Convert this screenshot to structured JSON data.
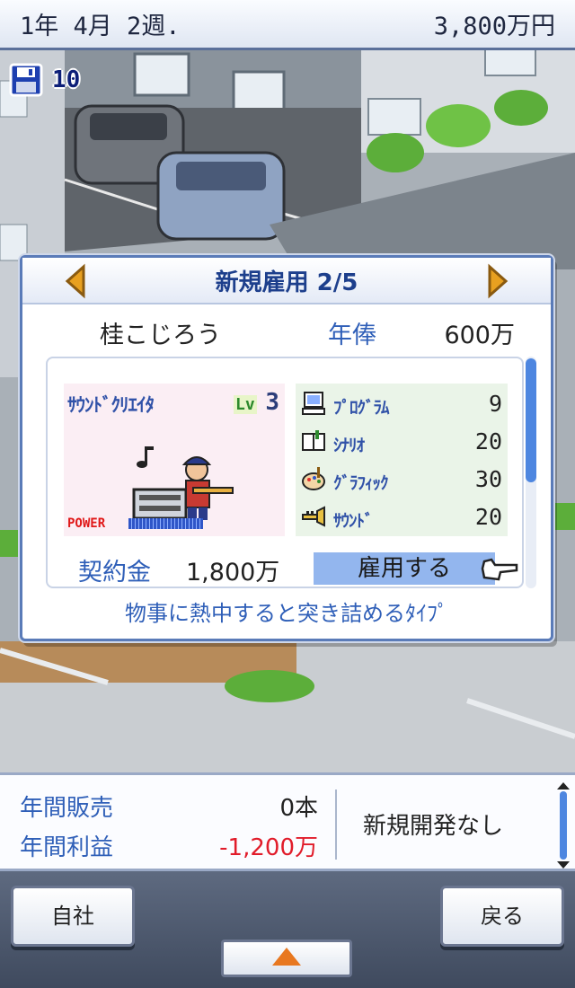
{
  "status": {
    "date": "1年 4月 2週.",
    "funds": "3,800万円"
  },
  "save": {
    "count": "10"
  },
  "dialog": {
    "title": "新規雇用 2/5",
    "name": "桂こじろう",
    "salary_label": "年俸",
    "salary_value": "600万",
    "job": "ｻｳﾝﾄﾞｸﾘｴｲﾀ",
    "level_tag": "Lv",
    "level": "3",
    "power_label": "POWER",
    "power_level": 0.55,
    "stats": [
      {
        "label": "ﾌﾟﾛｸﾞﾗﾑ",
        "value": "9",
        "icon": "computer-icon"
      },
      {
        "label": "ｼﾅﾘｵ",
        "value": "20",
        "icon": "book-icon"
      },
      {
        "label": "ｸﾞﾗﾌｨｯｸ",
        "value": "30",
        "icon": "palette-icon"
      },
      {
        "label": "ｻｳﾝﾄﾞ",
        "value": "20",
        "icon": "trumpet-icon"
      }
    ],
    "contract_label": "契約金",
    "contract_value": "1,800万",
    "hire_label": "雇用する",
    "description": "物事に熱中すると突き詰めるﾀｲﾌﾟ"
  },
  "info": {
    "sales_label": "年間販売",
    "sales_value": "0本",
    "profit_label": "年間利益",
    "profit_value": "-1,200万",
    "dev_status": "新規開発なし"
  },
  "nav": {
    "left_label": "自社",
    "right_label": "戻る"
  },
  "colors": {
    "accent": "#2f5fb8",
    "negative": "#e11c2a",
    "arrow": "#e8a020"
  }
}
